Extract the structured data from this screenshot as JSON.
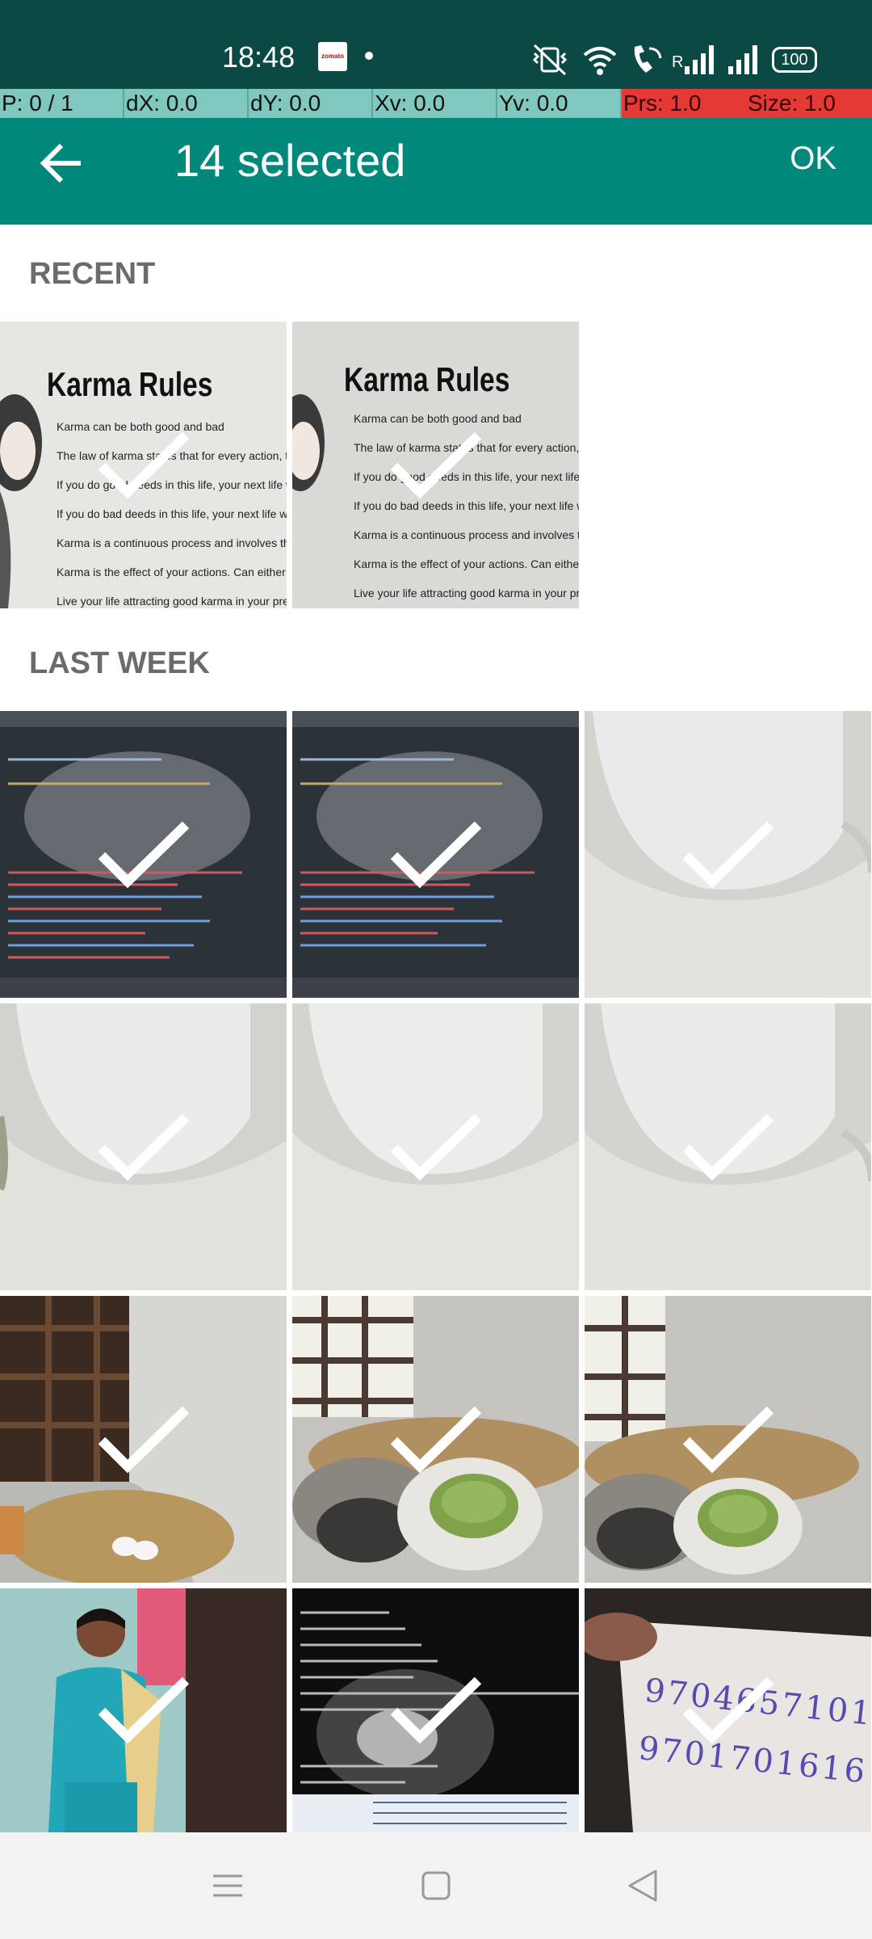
{
  "status_bar": {
    "time": "18:48",
    "zomato_label": "zomato",
    "battery": "100",
    "signal_label": "R"
  },
  "debug_overlay": {
    "pointer": "P: 0 / 1",
    "dx": "dX: 0.0",
    "dy": "dY: 0.0",
    "xv": "Xv: 0.0",
    "yv": "Yv: 0.0",
    "prs": "Prs: 1.0",
    "size": "Size: 1.0"
  },
  "app_bar": {
    "title": "14 selected",
    "ok_label": "OK"
  },
  "sections": {
    "recent": "RECENT",
    "last_week": "LAST WEEK"
  },
  "recent_photos": [
    {
      "name": "karma-rules-photo-1",
      "heading": "Karma Rules"
    },
    {
      "name": "karma-rules-photo-2",
      "heading": "Karma Rules"
    }
  ],
  "karma_lines": [
    "Karma can be both good and bad",
    "The law of karma states that for every action, there is a corresponding",
    "If you do good deeds in this life, your next life will have positive cons",
    "If you do bad deeds in this life, your next life will have negative cons",
    "Karma is a continuous process and involves the past, present, and f",
    "Karma is the effect of your actions. Can either be good or bad.",
    "Live your life attracting good karma in your present and future."
  ],
  "last_week_photos": [
    {
      "name": "code-screen-photo-1"
    },
    {
      "name": "code-screen-photo-2"
    },
    {
      "name": "white-cup-photo-1"
    },
    {
      "name": "white-cup-photo-2"
    },
    {
      "name": "white-cup-photo-3"
    },
    {
      "name": "white-cup-photo-4"
    },
    {
      "name": "nest-window-photo-1"
    },
    {
      "name": "nest-window-photo-2"
    },
    {
      "name": "nest-window-photo-3"
    },
    {
      "name": "person-photo"
    },
    {
      "name": "terminal-screen-photo"
    },
    {
      "name": "handwritten-note-photo"
    }
  ],
  "note_lines": [
    "9704657101",
    "9701701616"
  ],
  "colors": {
    "status_bar": "#0b4a44",
    "app_bar": "#00897b",
    "debug_cell": "#80c8bd",
    "debug_alert": "#e53935"
  }
}
